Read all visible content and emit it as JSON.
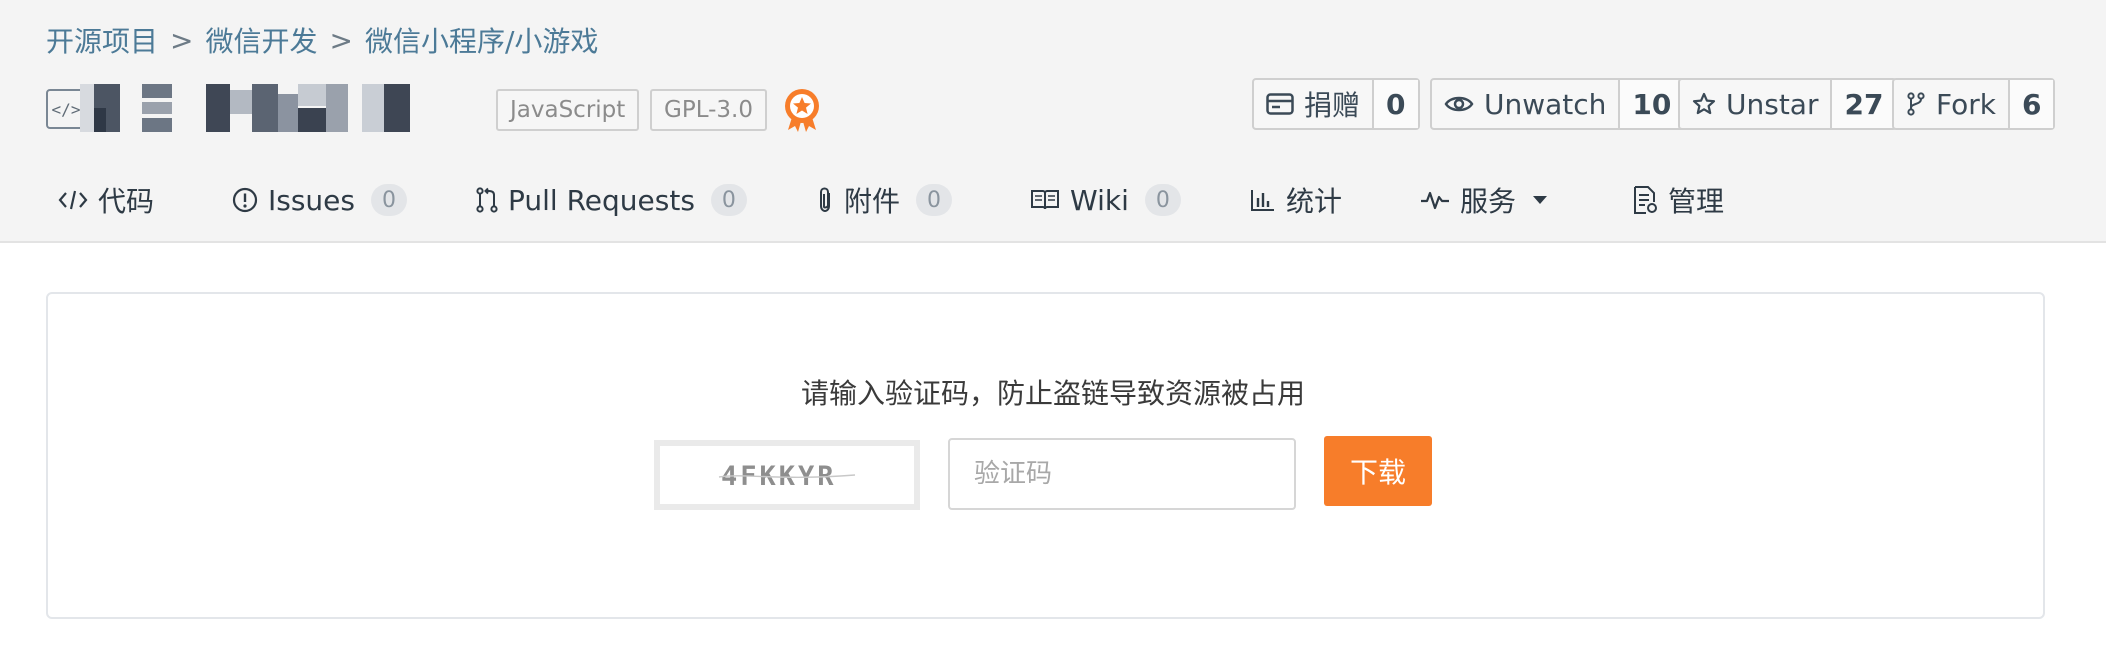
{
  "breadcrumb": {
    "items": [
      "开源项目",
      "微信开发",
      "微信小程序/小游戏"
    ],
    "separator": ">"
  },
  "repo": {
    "icon": "code-repo-icon",
    "icon_glyph": "</>",
    "tags": [
      "JavaScript",
      "GPL-3.0"
    ],
    "award_badge_icon": "award-medal-icon",
    "accent": "#f77d2a"
  },
  "stats": [
    {
      "icon": "wallet-icon",
      "label": "捐赠",
      "count": "0"
    },
    {
      "icon": "eye-icon",
      "label": "Unwatch",
      "count": "10"
    },
    {
      "icon": "star-icon",
      "label": "Unstar",
      "count": "27"
    },
    {
      "icon": "fork-icon",
      "label": "Fork",
      "count": "6"
    }
  ],
  "tabs": [
    {
      "icon": "code-icon",
      "label": "代码"
    },
    {
      "icon": "issue-icon",
      "label": "Issues",
      "count": "0"
    },
    {
      "icon": "pull-request-icon",
      "label": "Pull Requests",
      "count": "0"
    },
    {
      "icon": "paperclip-icon",
      "label": "附件",
      "count": "0"
    },
    {
      "icon": "book-icon",
      "label": "Wiki",
      "count": "0"
    },
    {
      "icon": "bar-chart-icon",
      "label": "统计"
    },
    {
      "icon": "pulse-icon",
      "label": "服务",
      "dropdown": true
    },
    {
      "icon": "document-icon",
      "label": "管理"
    }
  ],
  "download": {
    "prompt": "请输入验证码，防止盗链导致资源被占用",
    "captcha_text": "4FKKYR",
    "input_placeholder": "验证码",
    "input_value": "",
    "button_label": "下载"
  }
}
